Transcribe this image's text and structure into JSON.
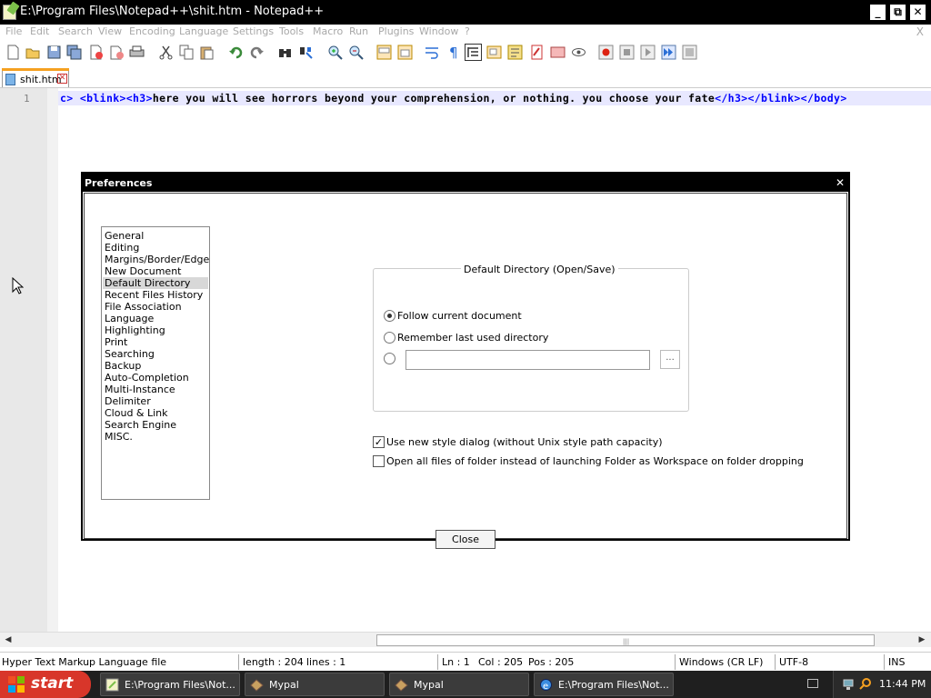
{
  "window": {
    "title": "E:\\Program Files\\Notepad++\\shit.htm - Notepad++",
    "minimize_glyph": "_",
    "maximize_glyph": "⧉",
    "close_glyph": "✕"
  },
  "menu": {
    "items": [
      "File",
      "Edit",
      "Search",
      "View",
      "Encoding",
      "Language",
      "Settings",
      "Tools",
      "Macro",
      "Run",
      "Plugins",
      "Window",
      "?"
    ],
    "close_glyph": "X"
  },
  "toolbar": {
    "icons": [
      "new-file-icon",
      "open-file-icon",
      "save-icon",
      "save-all-icon",
      "close-icon",
      "close-all-icon",
      "print-icon",
      "cut-icon",
      "copy-icon",
      "paste-icon",
      "undo-icon",
      "redo-icon",
      "find-icon",
      "replace-icon",
      "zoom-in-icon",
      "zoom-out-icon",
      "sync-vertical-icon",
      "sync-horizontal-icon",
      "word-wrap-icon",
      "show-all-chars-icon",
      "indent-guide-icon",
      "doc-map-icon",
      "function-list-icon",
      "folder-workspace-icon",
      "monitor-icon",
      "record-macro-icon",
      "stop-record-icon",
      "play-macro-icon",
      "run-macro-multiple-icon",
      "save-macro-icon"
    ]
  },
  "tab": {
    "label": "shit.htm",
    "close_glyph": "✕"
  },
  "editor": {
    "line_number": "1",
    "code": {
      "t1": "c>",
      "t2": "<blink><h3>",
      "t3": "here you will see horrors beyond your comprehension, or nothing. you choose your fate",
      "t4": "</h3></blink></body>"
    }
  },
  "hscroll": {
    "left_arrow": "◀",
    "right_arrow": "▶",
    "grip": "|||"
  },
  "statusbar": {
    "file_type": "Hyper Text Markup Language file",
    "length": "length : 204",
    "lines": "lines : 1",
    "ln": "Ln : 1",
    "col": "Col : 205",
    "pos": "Pos : 205",
    "eol": "Windows (CR LF)",
    "encoding": "UTF-8",
    "mode": "INS"
  },
  "dialog": {
    "title": "Preferences",
    "close_glyph": "✕",
    "categories": [
      "General",
      "Editing",
      "Margins/Border/Edge",
      "New Document",
      "Default Directory",
      "Recent Files History",
      "File Association",
      "Language",
      "Highlighting",
      "Print",
      "Searching",
      "Backup",
      "Auto-Completion",
      "Multi-Instance",
      "Delimiter",
      "Cloud & Link",
      "Search Engine",
      "MISC."
    ],
    "selected_category": "Default Directory",
    "group_label": "Default Directory (Open/Save)",
    "option_follow": "Follow current document",
    "option_remember": "Remember last used directory",
    "selected_option": "Follow current document",
    "dir_value": "",
    "browse_label": "...",
    "check_new_style": "Use new style dialog (without Unix style path capacity)",
    "check_new_style_checked": true,
    "check_open_all": "Open all files of folder instead of launching Folder as Workspace on folder dropping",
    "check_open_all_checked": false,
    "check_mark": "✓",
    "close_button": "Close"
  },
  "taskbar": {
    "start_label": "start",
    "tasks": [
      {
        "label": "E:\\Program Files\\Not...",
        "icon": "notepad-icon"
      },
      {
        "label": "Mypal",
        "icon": "mypal-icon"
      },
      {
        "label": "Mypal",
        "icon": "mypal-icon"
      },
      {
        "label": "E:\\Program Files\\Not...",
        "icon": "explorer-icon"
      }
    ],
    "clock": "11:44 PM"
  },
  "colors": {
    "tag": "#0000ff",
    "tab_accent": "#f5a020",
    "start_button": "#d8362a"
  }
}
